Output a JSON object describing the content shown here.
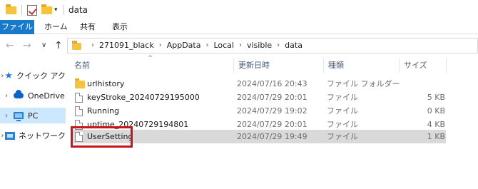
{
  "window": {
    "title": "data"
  },
  "ribbon": {
    "tabs": [
      "ファイル",
      "ホーム",
      "共有",
      "表示"
    ]
  },
  "address": {
    "crumbs": [
      "271091_black",
      "AppData",
      "Local",
      "visible",
      "data"
    ]
  },
  "nav_pane": {
    "items": [
      {
        "label": "クイック アク",
        "icon": "quick-access-star-icon"
      },
      {
        "label": "OneDrive",
        "icon": "onedrive-cloud-icon"
      },
      {
        "label": "PC",
        "icon": "pc-icon",
        "selected": true
      },
      {
        "label": "ネットワーク",
        "icon": "network-icon"
      }
    ]
  },
  "columns": {
    "name": "名前",
    "date": "更新日時",
    "type": "種類",
    "size": "サイズ"
  },
  "files": [
    {
      "name": "urlhistory",
      "date": "2024/07/16 20:43",
      "type": "ファイル フォルダー",
      "size": "",
      "icon": "folder-icon"
    },
    {
      "name": "keyStroke_20240729195000",
      "date": "2024/07/29 20:01",
      "type": "ファイル",
      "size": "5 KB",
      "icon": "file-icon"
    },
    {
      "name": "Running",
      "date": "2024/07/29 19:02",
      "type": "ファイル",
      "size": "0 KB",
      "icon": "file-icon"
    },
    {
      "name": "uptime_20240729194801",
      "date": "2024/07/29 20:01",
      "type": "ファイル",
      "size": "4 KB",
      "icon": "file-icon"
    },
    {
      "name": "UserSetting",
      "date": "2024/07/29 19:49",
      "type": "ファイル",
      "size": "1 KB",
      "icon": "file-icon",
      "selected": true
    }
  ],
  "colors": {
    "file_tab": "#1979ca",
    "selected_nav": "#cce8ff",
    "selected_row": "#d9d9d9",
    "highlight": "#c4161c"
  }
}
